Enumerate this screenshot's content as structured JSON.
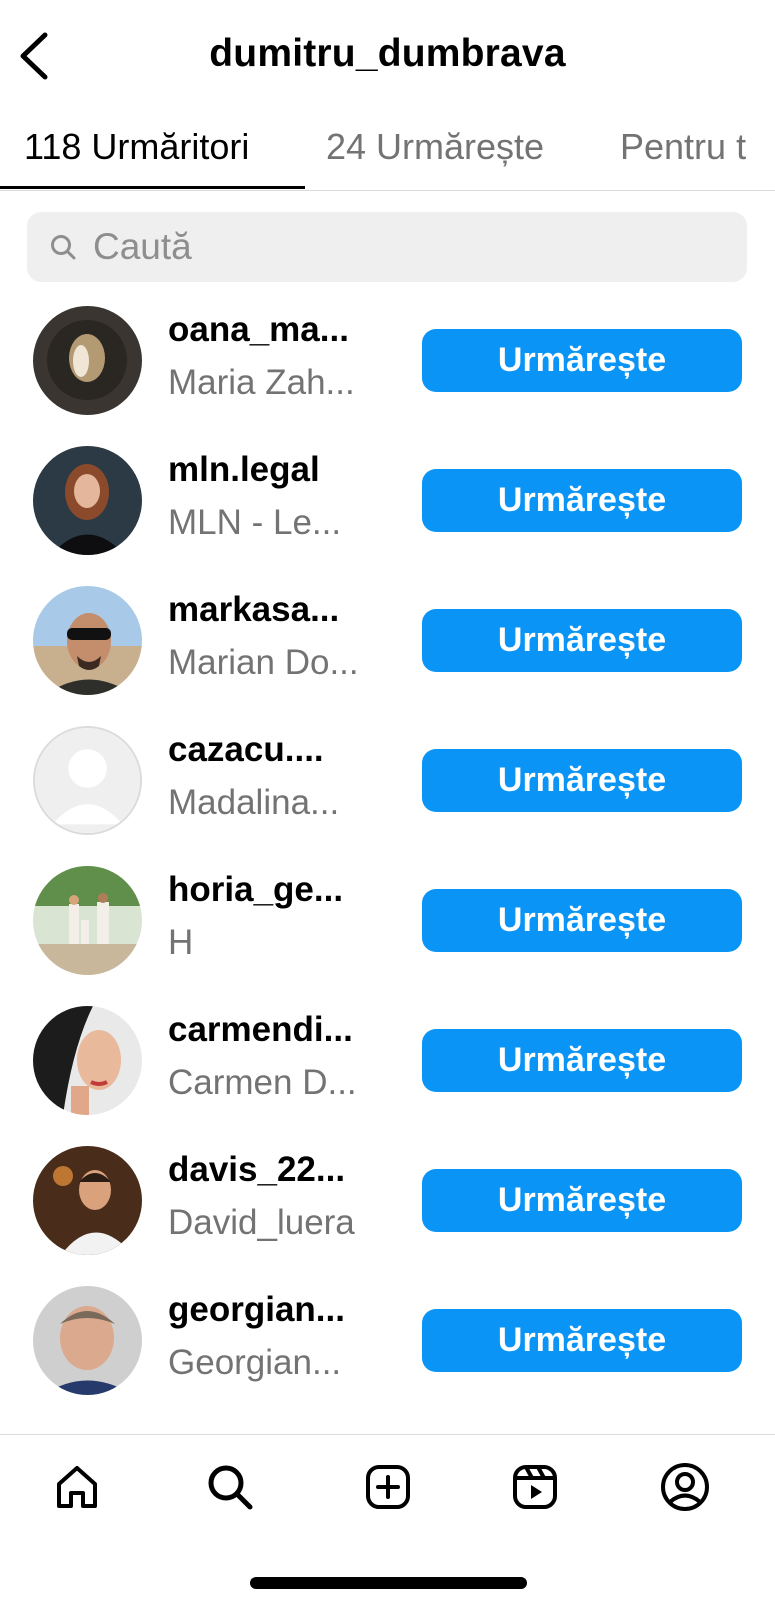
{
  "header": {
    "title": "dumitru_dumbrava",
    "back_icon": "chevron-left-icon"
  },
  "tabs": [
    {
      "label": "118 Urmăritori",
      "active": true
    },
    {
      "label": "24 Urmărește",
      "active": false
    },
    {
      "label": "Pentru t",
      "active": false
    }
  ],
  "search": {
    "placeholder": "Caută",
    "value": ""
  },
  "follow_label": "Urmărește",
  "users": [
    {
      "username": "oana_ma...",
      "fullname": "Maria Zah..."
    },
    {
      "username": "mln.legal",
      "fullname": "MLN - Le..."
    },
    {
      "username": "markasa...",
      "fullname": "Marian Do..."
    },
    {
      "username": "cazacu....",
      "fullname": "Madalina..."
    },
    {
      "username": "horia_ge...",
      "fullname": "H"
    },
    {
      "username": "carmendi...",
      "fullname": "Carmen D..."
    },
    {
      "username": "davis_22...",
      "fullname": "David_luera"
    },
    {
      "username": "georgian...",
      "fullname": "Georgian..."
    }
  ],
  "navbar": {
    "items": [
      "home-icon",
      "search-icon",
      "create-post-icon",
      "reels-icon",
      "profile-icon"
    ]
  },
  "colors": {
    "accent": "#0a95f6",
    "secondary_text": "#737373",
    "search_bg": "#efefef"
  }
}
